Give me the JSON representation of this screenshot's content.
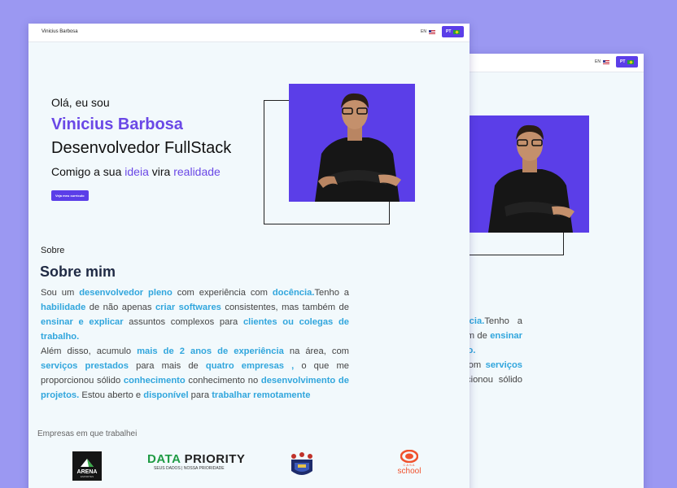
{
  "nav": {
    "brand": "Vinicius Barbosa",
    "lang_en": "EN",
    "lang_pt": "PT"
  },
  "hero": {
    "greeting": "Olá, eu sou",
    "name": "Vinicius Barbosa",
    "role": "Desenvolvedor FullStack",
    "tagline_pre": "Comigo a sua ",
    "tagline_hl1": "ideia",
    "tagline_mid": " vira ",
    "tagline_hl2": "realidade",
    "cta": "Veja meu currículo"
  },
  "about": {
    "section_label": "Sobre",
    "title": "Sobre mim",
    "p": [
      "Sou um ",
      "desenvolvedor pleno",
      " com experiência com ",
      "docência.",
      "Tenho a ",
      "habilidade",
      " de não apenas ",
      "criar softwares",
      " consistentes, mas também de ",
      "ensinar e explicar",
      " assuntos complexos para ",
      "clientes ou colegas de trabalho.",
      "Além disso, acumulo ",
      "mais de 2 anos de experiência",
      " na área, com ",
      "serviços prestados",
      " para mais de ",
      "quatro empresas ,",
      " o que me proporcionou sólido ",
      "conhecimento",
      " conhecimento no ",
      "desenvolvimento de projetos.",
      " Estou aberto e ",
      "disponível",
      " para ",
      "trabalhar remotamente"
    ]
  },
  "companies": {
    "label": "Empresas em que trabalhei",
    "arena": "ARENA",
    "arena_sub": "ESPORTES",
    "data_priority_a": "DATA",
    "data_priority_b": "PRIORITY",
    "data_priority_sub": "SEUS DADOS | NOSSA PRIORIDADE",
    "casa_top": "CASA",
    "casa_bottom": "school"
  },
  "colors": {
    "accent": "#5b3ee8",
    "highlight": "#31a6dd",
    "background": "#9b98f2"
  }
}
